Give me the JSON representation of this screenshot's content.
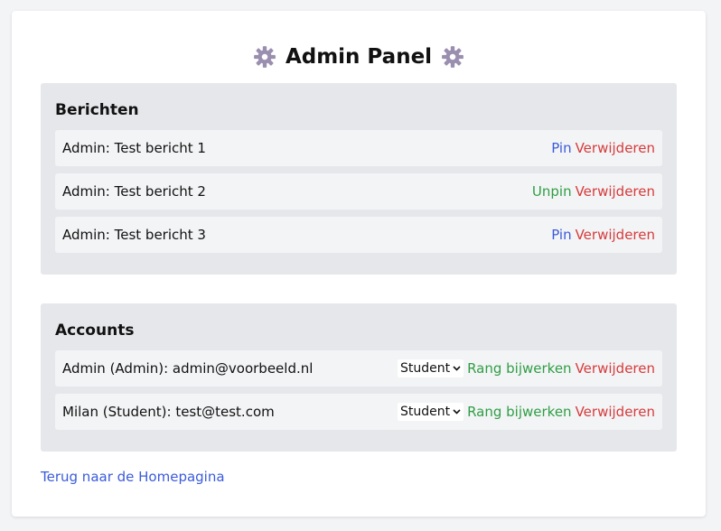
{
  "page": {
    "title": "Admin Panel",
    "back_link": "Terug naar de Homepagina"
  },
  "messages": {
    "heading": "Berichten",
    "items": [
      {
        "text": "Admin: Test bericht 1",
        "pin_label": "Pin",
        "delete_label": "Verwijderen"
      },
      {
        "text": "Admin: Test bericht 2",
        "pin_label": "Unpin",
        "delete_label": "Verwijderen"
      },
      {
        "text": "Admin: Test bericht 3",
        "pin_label": "Pin",
        "delete_label": "Verwijderen"
      }
    ]
  },
  "accounts": {
    "heading": "Accounts",
    "items": [
      {
        "text": "Admin (Admin): admin@voorbeeld.nl",
        "role_selected": "Student",
        "update_label": "Rang bijwerken",
        "delete_label": "Verwijderen"
      },
      {
        "text": "Milan (Student): test@test.com",
        "role_selected": "Student",
        "update_label": "Rang bijwerken",
        "delete_label": "Verwijderen"
      }
    ]
  },
  "icons": {
    "title_left": "gear-icon",
    "title_right": "gear-icon",
    "select_chevron": "chevron-down-icon"
  },
  "colors": {
    "pin": "#3b5bdb",
    "unpin": "#2f9e44",
    "delete": "#d63b3b",
    "update": "#2f9e44",
    "link": "#3b5bdb",
    "section_bg": "#e5e7eb",
    "row_bg": "#f3f4f6"
  }
}
